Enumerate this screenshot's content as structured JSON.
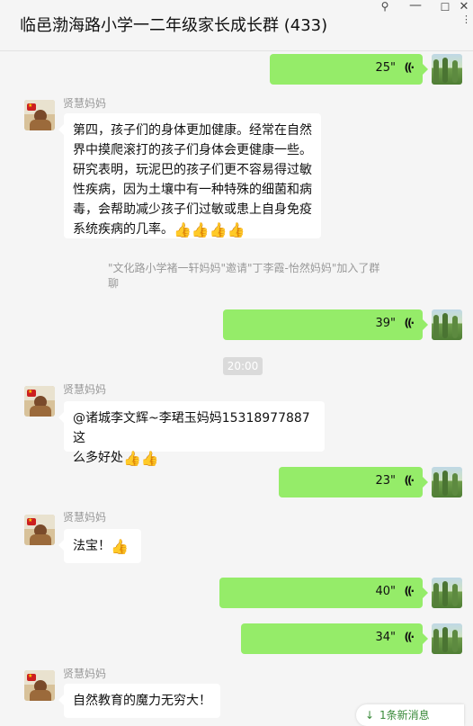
{
  "window": {
    "title": "临邑渤海路小学一二年级家长成长群 (433)",
    "pin_glyph": "⚲",
    "minimize_glyph": "—",
    "maximize_glyph": "☐",
    "close_glyph": "✕",
    "more_glyph": "⋮"
  },
  "messages": [
    {
      "side": "me",
      "type": "voice",
      "duration": "25\""
    },
    {
      "side": "other",
      "sender": "贤慧妈妈",
      "lines": [
        "第四，孩子们的身体更加健康。经常在自然",
        "界中摸爬滚打的孩子们身体会更健康一些。",
        "研究表明，玩泥巴的孩子们更不容易得过敏",
        "性疾病，因为土壤中有一种特殊的细菌和病",
        "毒，会帮助减少孩子们过敏或患上自身免疫",
        "系统疾病的几率。"
      ],
      "thumbs": 4
    },
    {
      "type": "system",
      "text": "\"文化路小学褚一轩妈妈\"邀请\"丁李霞-怡然妈妈\"加入了群聊"
    },
    {
      "side": "me",
      "type": "voice",
      "duration": "39\""
    },
    {
      "type": "time",
      "text": "20:00"
    },
    {
      "side": "other",
      "sender": "贤慧妈妈",
      "lines": [
        "@诸城李文辉~李珺玉妈妈15318977887 这",
        "么多好处"
      ],
      "thumbs": 2
    },
    {
      "side": "me",
      "type": "voice",
      "duration": "23\""
    },
    {
      "side": "other",
      "sender": "贤慧妈妈",
      "lines": [
        "法宝！"
      ],
      "thumbs": 1
    },
    {
      "side": "me",
      "type": "voice",
      "duration": "40\""
    },
    {
      "side": "me",
      "type": "voice",
      "duration": "34\""
    },
    {
      "side": "other",
      "sender": "贤慧妈妈",
      "lines": [
        "自然教育的魔力无穷大！"
      ],
      "thumbs": 0
    }
  ],
  "thumb_glyph": "👍",
  "wave_glyph": "((·",
  "new_messages": "1条新消息",
  "new_arrow": "↓",
  "colors": {
    "my_bubble": "#95ec69",
    "other_bubble": "#ffffff",
    "background": "#f5f5f5"
  }
}
